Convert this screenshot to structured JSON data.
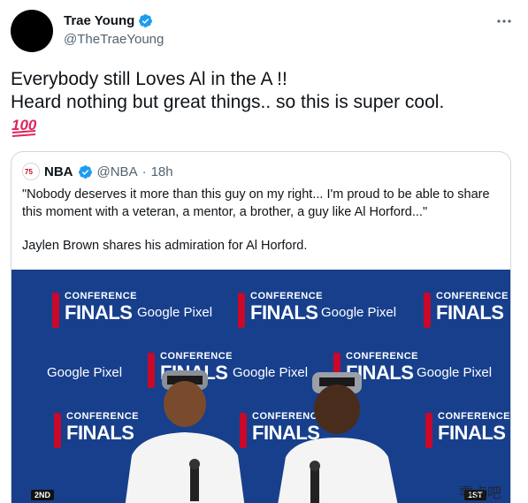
{
  "tweet": {
    "author_name": "Trae Young",
    "author_handle": "@TheTraeYoung",
    "more_icon": "ellipsis-icon",
    "text_lines": [
      "Everybody still Loves Al in the A !!",
      "Heard nothing but great things.. so this is super cool."
    ],
    "emoji": "hundred-points-emoji"
  },
  "quote": {
    "author_name": "NBA",
    "author_handle": "@NBA",
    "separator": "·",
    "time": "18h",
    "text_paragraphs": [
      "\"Nobody deserves it more than this guy on my right... I'm proud to be able to share this moment with a veteran, a mentor, a brother, a guy like Al Horford...\"",
      "Jaylen Brown shares his admiration for Al Horford."
    ]
  },
  "media": {
    "backdrop_title_top": "CONFERENCE",
    "backdrop_title_bottom": "FINALS",
    "backdrop_presented": "Presented by Google Pixel",
    "sponsor": "Google Pixel",
    "left_badge": "2ND",
    "right_badge": "1ST",
    "watermark": "零点吧"
  },
  "colors": {
    "verified": "#1d9bf0",
    "backdrop": "#173f8c",
    "text_secondary": "#536471",
    "emoji_red": "#e0245e"
  }
}
